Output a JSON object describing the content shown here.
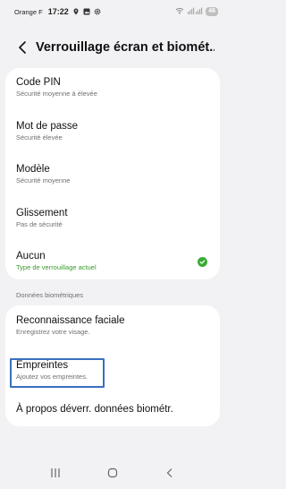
{
  "status": {
    "carrier": "Orange F",
    "time": "17:22",
    "battery": "46"
  },
  "header": {
    "title": "Verrouillage écran et biomét..."
  },
  "lock_options": [
    {
      "label": "Code PIN",
      "sub": "Sécurité moyenne à élevée"
    },
    {
      "label": "Mot de passe",
      "sub": "Sécurité élevée"
    },
    {
      "label": "Modèle",
      "sub": "Sécurité moyenne"
    },
    {
      "label": "Glissement",
      "sub": "Pas de sécurité"
    },
    {
      "label": "Aucun",
      "sub": "Type de verrouillage actuel",
      "selected": true
    }
  ],
  "biometrics": {
    "section_title": "Données biométriques",
    "items": [
      {
        "label": "Reconnaissance faciale",
        "sub": "Enregistrez votre visage."
      },
      {
        "label": "Empreintes",
        "sub": "Ajoutez vos empreintes."
      },
      {
        "label": "À propos déverr. données biométr."
      }
    ]
  },
  "colors": {
    "background": "#f2f2f4",
    "accent_green": "#3aaa35",
    "highlight_blue": "#3a6fbf"
  }
}
